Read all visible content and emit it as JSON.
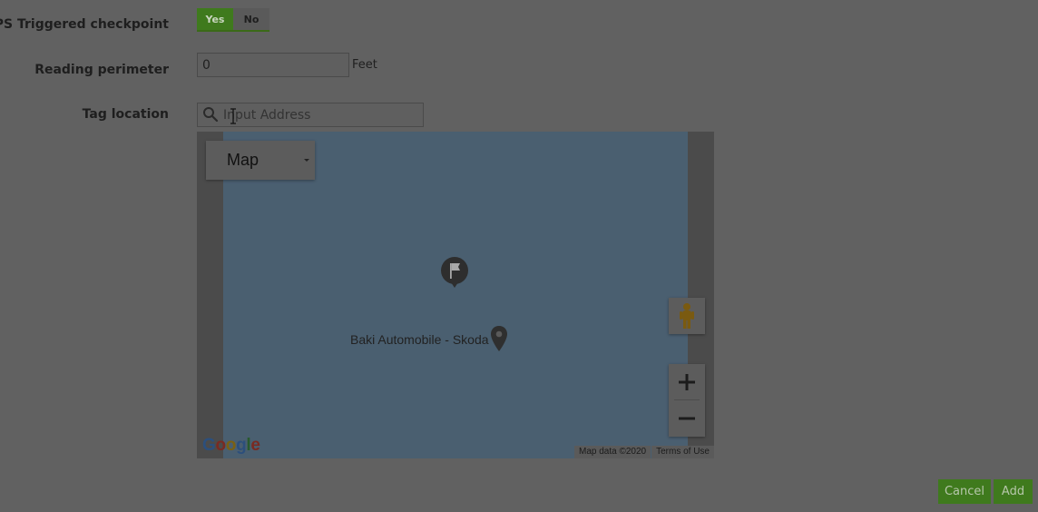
{
  "form": {
    "gps_label": "GPS Triggered checkpoint",
    "gps_toggle": {
      "yes": "Yes",
      "no": "No",
      "selected": "Yes"
    },
    "perimeter_label": "Reading perimeter",
    "perimeter_value": "0",
    "perimeter_unit": "Feet",
    "tag_label": "Tag location",
    "tag_placeholder": "Input Address"
  },
  "map": {
    "type_selector": "Map",
    "place_label": "Baki Automobile - Skoda",
    "logo": "Google",
    "attribution": {
      "data": "Map data ©2020",
      "terms": "Terms of Use"
    },
    "zoom_in": "+",
    "zoom_out": "−"
  },
  "footer": {
    "cancel": "Cancel",
    "add": "Add"
  },
  "colors": {
    "accent": "#3f7a1d",
    "overlay": "#616161",
    "water": "#4a5f70"
  }
}
